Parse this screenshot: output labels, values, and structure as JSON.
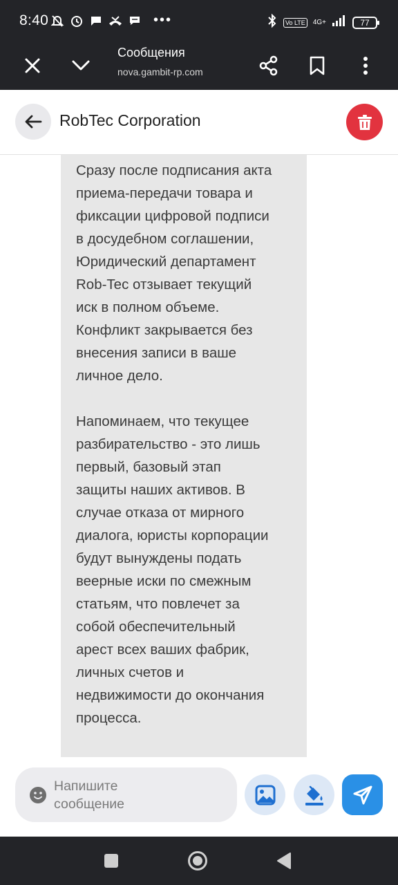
{
  "status_bar": {
    "time": "8:40",
    "icons_left": [
      "alarm-off-icon",
      "alarm-icon",
      "chat-bubble-icon",
      "missed-call-icon",
      "message-icon"
    ],
    "more": "•••",
    "volte": "Vo LTE",
    "network": "4G+",
    "battery": "77"
  },
  "browser": {
    "title": "Сообщения",
    "url": "nova.gambit-rp.com"
  },
  "chat": {
    "title": "RobTec Corporation"
  },
  "message": {
    "text": "Сразу после подписания акта\nприема-передачи товара и\nфиксации цифровой подписи\nв досудебном соглашении,\nЮридический департамент\nRob-Tec отзывает текущий\nиск в полном объеме.\nКонфликт закрывается без\nвнесения записи в ваше\nличное дело.\n\nНапоминаем, что текущее\nразбирательство - это лишь\nпервый, базовый этап\nзащиты наших активов. В\nслучае отказа от мирного\nдиалога, юристы корпорации\nбудут вынуждены подать\nвеерные иски по смежным\nстатьям, что повлечет за\nсобой обеспечительный\nарест всех ваших фабрик,\nличных счетов и\nнедвижимости до окончания\nпроцесса."
  },
  "composer": {
    "placeholder": "Напишите\nсообщение"
  },
  "colors": {
    "bar_bg": "#232428",
    "bubble_bg": "#e7e7e7",
    "delete_red": "#e2333f",
    "send_blue": "#2a90e6",
    "icon_blue": "#1e6fd0"
  }
}
